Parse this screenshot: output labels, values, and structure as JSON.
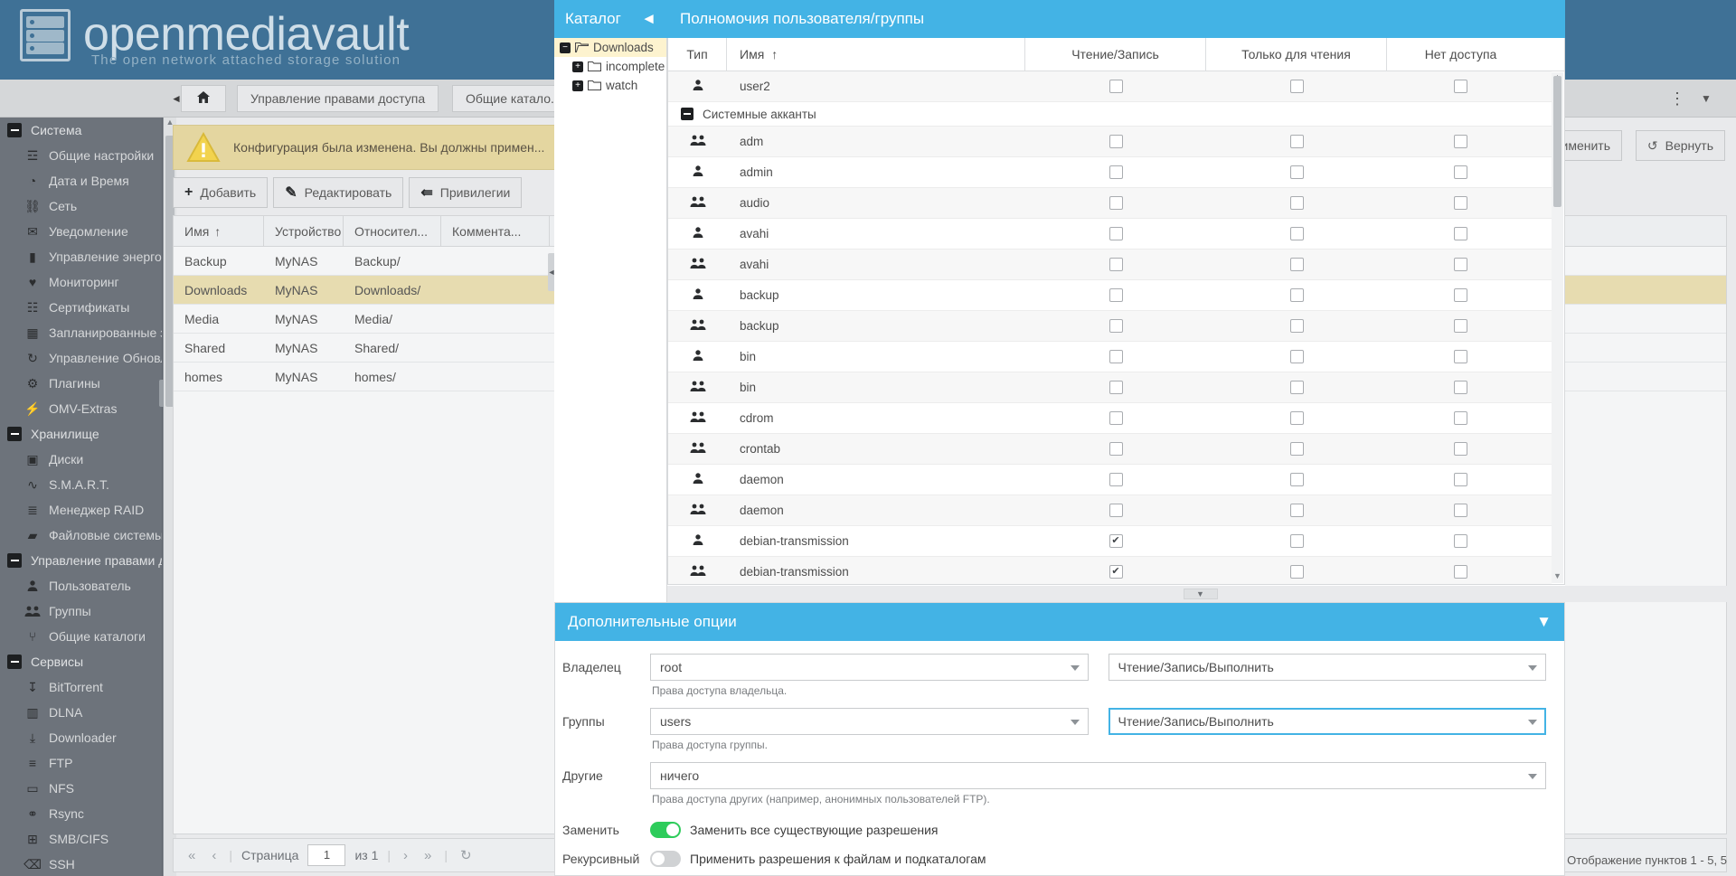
{
  "app": {
    "brand": "openmediavault",
    "tagline": "The open network attached storage solution"
  },
  "toolbar": {
    "collapse_icon": "chevron-left-icon",
    "home_icon": "home-icon",
    "tabs": [
      {
        "label": "Управление правами доступа"
      },
      {
        "label": "Общие катало..."
      }
    ],
    "kebab_icon": "more-vertical-icon",
    "caret_icon": "chevron-down-icon"
  },
  "notice": {
    "text": "Конфигурация была изменена. Вы должны примен...",
    "icon": "warning-triangle-icon",
    "apply_label": "Применить",
    "apply_icon": "check-icon",
    "revert_label": "Вернуть",
    "revert_icon": "undo-icon"
  },
  "commands": [
    {
      "label": "Добавить",
      "icon": "plus-icon"
    },
    {
      "label": "Редактировать",
      "icon": "pencil-icon"
    },
    {
      "label": "Привилегии",
      "icon": "share-icon"
    }
  ],
  "shares_grid": {
    "columns": [
      "Имя",
      "Устройство",
      "Относител...",
      "Коммента..."
    ],
    "sort_column": "Имя",
    "sort_icon": "arrow-up-icon",
    "rows": [
      {
        "name": "Backup",
        "device": "MyNAS",
        "relative": "Backup/",
        "comment": "",
        "selected": false
      },
      {
        "name": "Downloads",
        "device": "MyNAS",
        "relative": "Downloads/",
        "comment": "",
        "selected": true
      },
      {
        "name": "Media",
        "device": "MyNAS",
        "relative": "Media/",
        "comment": "",
        "selected": false
      },
      {
        "name": "Shared",
        "device": "MyNAS",
        "relative": "Shared/",
        "comment": "",
        "selected": false
      },
      {
        "name": "homes",
        "device": "MyNAS",
        "relative": "homes/",
        "comment": "",
        "selected": false
      }
    ]
  },
  "pager": {
    "first_icon": "double-chevron-left-icon",
    "prev_icon": "chevron-left-icon",
    "page_label": "Страница",
    "page_value": "1",
    "of_label": "из 1",
    "next_icon": "chevron-right-icon",
    "last_icon": "double-chevron-right-icon",
    "refresh_icon": "refresh-icon",
    "status": "Отображение пунктов 1 - 5, 5"
  },
  "sidebar": {
    "groups": [
      {
        "label": "Система",
        "expander": "minus-icon",
        "items": [
          {
            "label": "Общие настройки",
            "icon": "sliders-icon"
          },
          {
            "label": "Дата и Время",
            "icon": "clock-icon"
          },
          {
            "label": "Сеть",
            "icon": "network-icon"
          },
          {
            "label": "Уведомление",
            "icon": "mail-icon"
          },
          {
            "label": "Управление энергопо...",
            "icon": "battery-icon"
          },
          {
            "label": "Мониторинг",
            "icon": "heartbeat-icon"
          },
          {
            "label": "Сертификаты",
            "icon": "certificate-icon"
          },
          {
            "label": "Запланированные за...",
            "icon": "calendar-clock-icon"
          },
          {
            "label": "Управление Обновле...",
            "icon": "refresh-cycle-icon"
          },
          {
            "label": "Плагины",
            "icon": "plugin-icon"
          },
          {
            "label": "OMV-Extras",
            "icon": "plug-icon"
          }
        ]
      },
      {
        "label": "Хранилище",
        "expander": "minus-icon",
        "items": [
          {
            "label": "Диски",
            "icon": "hdd-icon"
          },
          {
            "label": "S.M.A.R.T.",
            "icon": "pulse-icon"
          },
          {
            "label": "Менеджер RAID",
            "icon": "stack-icon"
          },
          {
            "label": "Файловые системы",
            "icon": "folders-icon"
          }
        ]
      },
      {
        "label": "Управление правами до...",
        "expander": "minus-icon",
        "items": [
          {
            "label": "Пользователь",
            "icon": "user-icon"
          },
          {
            "label": "Группы",
            "icon": "users-icon"
          },
          {
            "label": "Общие каталоги",
            "icon": "share-icon"
          }
        ]
      },
      {
        "label": "Сервисы",
        "expander": "minus-icon",
        "items": [
          {
            "label": "BitTorrent",
            "icon": "download-tray-icon"
          },
          {
            "label": "DLNA",
            "icon": "film-icon"
          },
          {
            "label": "Downloader",
            "icon": "download-box-icon"
          },
          {
            "label": "FTP",
            "icon": "server-icon"
          },
          {
            "label": "NFS",
            "icon": "monitor-icon"
          },
          {
            "label": "Rsync",
            "icon": "sync-nodes-icon"
          },
          {
            "label": "SMB/CIFS",
            "icon": "windows-icon"
          },
          {
            "label": "SSH",
            "icon": "terminal-icon"
          }
        ]
      }
    ]
  },
  "catalog": {
    "title": "Каталог",
    "collapse_icon": "chevron-left-icon",
    "tree": [
      {
        "label": "Downloads",
        "expander": "minus-icon",
        "folder_icon": "folder-open-icon",
        "depth": 0,
        "selected": true
      },
      {
        "label": "incomplete",
        "expander": "plus-icon",
        "folder_icon": "folder-icon",
        "depth": 1,
        "selected": false
      },
      {
        "label": "watch",
        "expander": "plus-icon",
        "folder_icon": "folder-icon",
        "depth": 1,
        "selected": false
      }
    ]
  },
  "permissions": {
    "title": "Полномочия пользователя/группы",
    "columns": {
      "type": "Тип",
      "name": "Имя",
      "name_sort_icon": "arrow-up-icon",
      "read_write": "Чтение/Запись",
      "read_only": "Только для чтения",
      "no_access": "Нет доступа"
    },
    "rows": [
      {
        "kind": "row",
        "icon": "user-icon",
        "name": "user2",
        "rw": false,
        "ro": false,
        "no": false
      },
      {
        "kind": "group",
        "toggle": "minus-icon",
        "name": "Системные акканты_placeholder"
      },
      {
        "kind": "row",
        "icon": "users-icon",
        "name": "adm",
        "rw": false,
        "ro": false,
        "no": false
      },
      {
        "kind": "row",
        "icon": "user-icon",
        "name": "admin",
        "rw": false,
        "ro": false,
        "no": false
      },
      {
        "kind": "row",
        "icon": "users-icon",
        "name": "audio",
        "rw": false,
        "ro": false,
        "no": false
      },
      {
        "kind": "row",
        "icon": "user-icon",
        "name": "avahi",
        "rw": false,
        "ro": false,
        "no": false
      },
      {
        "kind": "row",
        "icon": "users-icon",
        "name": "avahi",
        "rw": false,
        "ro": false,
        "no": false
      },
      {
        "kind": "row",
        "icon": "user-icon",
        "name": "backup",
        "rw": false,
        "ro": false,
        "no": false
      },
      {
        "kind": "row",
        "icon": "users-icon",
        "name": "backup",
        "rw": false,
        "ro": false,
        "no": false
      },
      {
        "kind": "row",
        "icon": "user-icon",
        "name": "bin",
        "rw": false,
        "ro": false,
        "no": false
      },
      {
        "kind": "row",
        "icon": "users-icon",
        "name": "bin",
        "rw": false,
        "ro": false,
        "no": false
      },
      {
        "kind": "row",
        "icon": "users-icon",
        "name": "cdrom",
        "rw": false,
        "ro": false,
        "no": false
      },
      {
        "kind": "row",
        "icon": "users-icon",
        "name": "crontab",
        "rw": false,
        "ro": false,
        "no": false
      },
      {
        "kind": "row",
        "icon": "user-icon",
        "name": "daemon",
        "rw": false,
        "ro": false,
        "no": false
      },
      {
        "kind": "row",
        "icon": "users-icon",
        "name": "daemon",
        "rw": false,
        "ro": false,
        "no": false
      },
      {
        "kind": "row",
        "icon": "user-icon",
        "name": "debian-transmission",
        "rw": true,
        "ro": false,
        "no": false
      },
      {
        "kind": "row",
        "icon": "users-icon",
        "name": "debian-transmission",
        "rw": true,
        "ro": false,
        "no": false
      }
    ],
    "group_header_label": "Системные акканты"
  },
  "splitter": {
    "icon": "chevron-down-icon"
  },
  "extra": {
    "title": "Дополнительные опции",
    "collapse_icon": "chevron-down-icon",
    "owner": {
      "label": "Владелец",
      "value": "root",
      "perm_value": "Чтение/Запись/Выполнить",
      "hint": "Права доступа владельца."
    },
    "group": {
      "label": "Группы",
      "value": "users",
      "perm_value": "Чтение/Запись/Выполнить",
      "hint": "Права доступа группы."
    },
    "others": {
      "label": "Другие",
      "value": "ничего",
      "hint": "Права доступа других (например, анонимных пользователей FTP)."
    },
    "replace": {
      "label": "Заменить",
      "text": "Заменить все существующие разрешения",
      "on": true
    },
    "recursive": {
      "label": "Рекурсивный",
      "text": "Применить разрешения к файлам и подкаталогам",
      "on": false
    }
  },
  "colors": {
    "brand_header": "#3f7196",
    "dialog_header": "#43b3e5",
    "warning_bg": "#e4d6a0",
    "selected_row": "#e7dcb0",
    "toggle_on": "#2ecc5b"
  }
}
